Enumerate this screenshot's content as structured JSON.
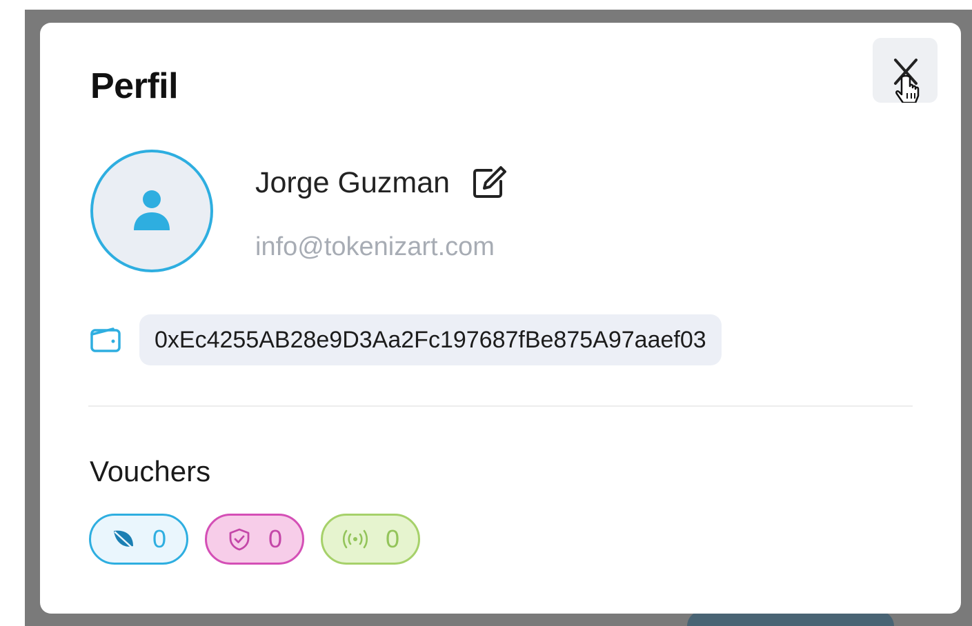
{
  "modal": {
    "title": "Perfil",
    "close_icon": "close-icon"
  },
  "profile": {
    "avatar_icon": "user-icon",
    "name": "Jorge Guzman",
    "edit_icon": "edit-icon",
    "email": "info@tokenizart.com",
    "wallet_icon": "wallet-icon",
    "wallet_address": "0xEc4255AB28e9D3Aa2Fc197687fBe875A97aaef03"
  },
  "vouchers": {
    "title": "Vouchers",
    "items": [
      {
        "icon": "leaf-icon",
        "count": "0",
        "color": "#2eaee0"
      },
      {
        "icon": "shield-icon",
        "count": "0",
        "color": "#d44fb6"
      },
      {
        "icon": "broadcast-icon",
        "count": "0",
        "color": "#a6d16a"
      }
    ]
  },
  "colors": {
    "accent": "#2eaee0",
    "backdrop": "#7a7a7a"
  }
}
